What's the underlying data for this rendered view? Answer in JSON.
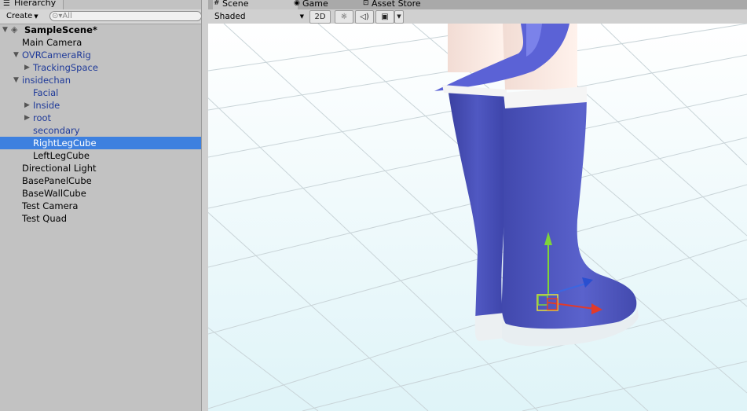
{
  "hierarchy": {
    "tab_label": "Hierarchy",
    "create_label": "Create",
    "search_placeholder": "All",
    "items": [
      {
        "label": "SampleScene*",
        "indent": 0,
        "arrow": "expanded",
        "style": "scene",
        "selected": false
      },
      {
        "label": "Main Camera",
        "indent": 1,
        "arrow": "none",
        "style": "normal",
        "selected": false
      },
      {
        "label": "OVRCameraRig",
        "indent": 1,
        "arrow": "expanded",
        "style": "prefab",
        "selected": false
      },
      {
        "label": "TrackingSpace",
        "indent": 2,
        "arrow": "collapsed",
        "style": "prefab",
        "selected": false
      },
      {
        "label": "insidechan",
        "indent": 1,
        "arrow": "expanded",
        "style": "prefab",
        "selected": false
      },
      {
        "label": "Facial",
        "indent": 2,
        "arrow": "none",
        "style": "prefab",
        "selected": false
      },
      {
        "label": "Inside",
        "indent": 2,
        "arrow": "collapsed",
        "style": "prefab",
        "selected": false
      },
      {
        "label": "root",
        "indent": 2,
        "arrow": "collapsed",
        "style": "prefab",
        "selected": false
      },
      {
        "label": "secondary",
        "indent": 2,
        "arrow": "none",
        "style": "prefab",
        "selected": false
      },
      {
        "label": "RightLegCube",
        "indent": 2,
        "arrow": "none",
        "style": "normal",
        "selected": true
      },
      {
        "label": "LeftLegCube",
        "indent": 2,
        "arrow": "none",
        "style": "normal",
        "selected": false
      },
      {
        "label": "Directional Light",
        "indent": 1,
        "arrow": "none",
        "style": "normal",
        "selected": false
      },
      {
        "label": "BasePanelCube",
        "indent": 1,
        "arrow": "none",
        "style": "normal",
        "selected": false
      },
      {
        "label": "BaseWallCube",
        "indent": 1,
        "arrow": "none",
        "style": "normal",
        "selected": false
      },
      {
        "label": "Test Camera",
        "indent": 1,
        "arrow": "none",
        "style": "normal",
        "selected": false
      },
      {
        "label": "Test Quad",
        "indent": 1,
        "arrow": "none",
        "style": "normal",
        "selected": false
      }
    ]
  },
  "tabs": {
    "scene": "Scene",
    "game": "Game",
    "asset_store": "Asset Store"
  },
  "toolbar": {
    "shading_mode": "Shaded",
    "mode_2d": "2D"
  },
  "icons": {
    "hierarchy": "list-icon",
    "scene": "grid-icon",
    "game": "gamepad-icon",
    "asset_store": "shopping-bag-icon",
    "lighting": "sun-icon",
    "audio": "speaker-icon",
    "effects": "image-icon"
  },
  "colors": {
    "selection": "#3d80df",
    "prefab_text": "#1f3a99",
    "boot_blue": "#4a52b5"
  }
}
